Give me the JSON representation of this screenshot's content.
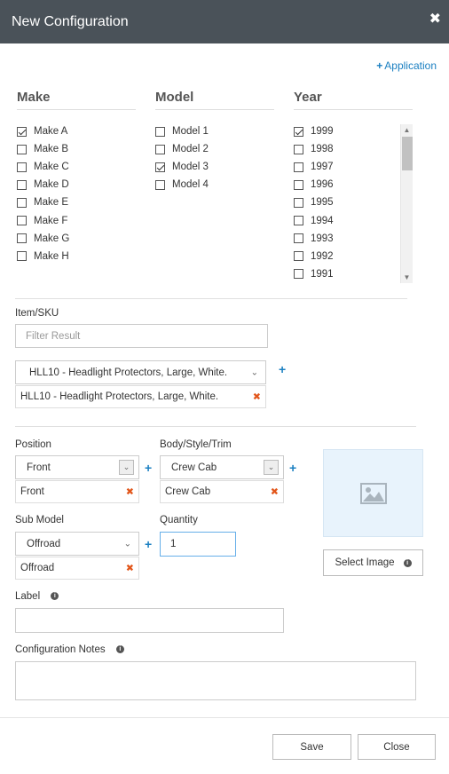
{
  "header": {
    "title": "New Configuration",
    "close_icon": "close-icon"
  },
  "add_application": {
    "label": "Application"
  },
  "make": {
    "heading": "Make",
    "items": [
      {
        "label": "Make A",
        "checked": true
      },
      {
        "label": "Make B",
        "checked": false
      },
      {
        "label": "Make C",
        "checked": false
      },
      {
        "label": "Make D",
        "checked": false
      },
      {
        "label": "Make E",
        "checked": false
      },
      {
        "label": "Make F",
        "checked": false
      },
      {
        "label": "Make G",
        "checked": false
      },
      {
        "label": "Make H",
        "checked": false
      }
    ]
  },
  "model": {
    "heading": "Model",
    "items": [
      {
        "label": "Model 1",
        "checked": false
      },
      {
        "label": "Model 2",
        "checked": false
      },
      {
        "label": "Model 3",
        "checked": true
      },
      {
        "label": "Model 4",
        "checked": false
      }
    ]
  },
  "year": {
    "heading": "Year",
    "items": [
      {
        "label": "1999",
        "checked": true
      },
      {
        "label": "1998",
        "checked": false
      },
      {
        "label": "1997",
        "checked": false
      },
      {
        "label": "1996",
        "checked": false
      },
      {
        "label": "1995",
        "checked": false
      },
      {
        "label": "1994",
        "checked": false
      },
      {
        "label": "1993",
        "checked": false
      },
      {
        "label": "1992",
        "checked": false
      },
      {
        "label": "1991",
        "checked": false
      }
    ]
  },
  "item_sku": {
    "label": "Item/SKU",
    "filter_placeholder": "Filter Result",
    "selected_option": "HLL10 - Headlight Protectors, Large, White.",
    "tag": "HLL10 - Headlight Protectors, Large, White."
  },
  "position": {
    "label": "Position",
    "selected": "Front",
    "tag": "Front"
  },
  "body_style": {
    "label": "Body/Style/Trim",
    "selected": "Crew Cab",
    "tag": "Crew Cab"
  },
  "sub_model": {
    "label": "Sub Model",
    "selected": "Offroad",
    "tag": "Offroad"
  },
  "quantity": {
    "label": "Quantity",
    "value": "1"
  },
  "image": {
    "select_label": "Select Image",
    "placeholder_icon": "image-icon"
  },
  "label_field": {
    "label": "Label",
    "value": ""
  },
  "notes": {
    "label": "Configuration Notes",
    "value": ""
  },
  "footer": {
    "save_label": "Save",
    "close_label": "Close"
  },
  "colors": {
    "header_bg": "#4a5259",
    "accent": "#1a7fc1",
    "remove": "#e2561b",
    "image_bg": "#e8f3fc"
  }
}
